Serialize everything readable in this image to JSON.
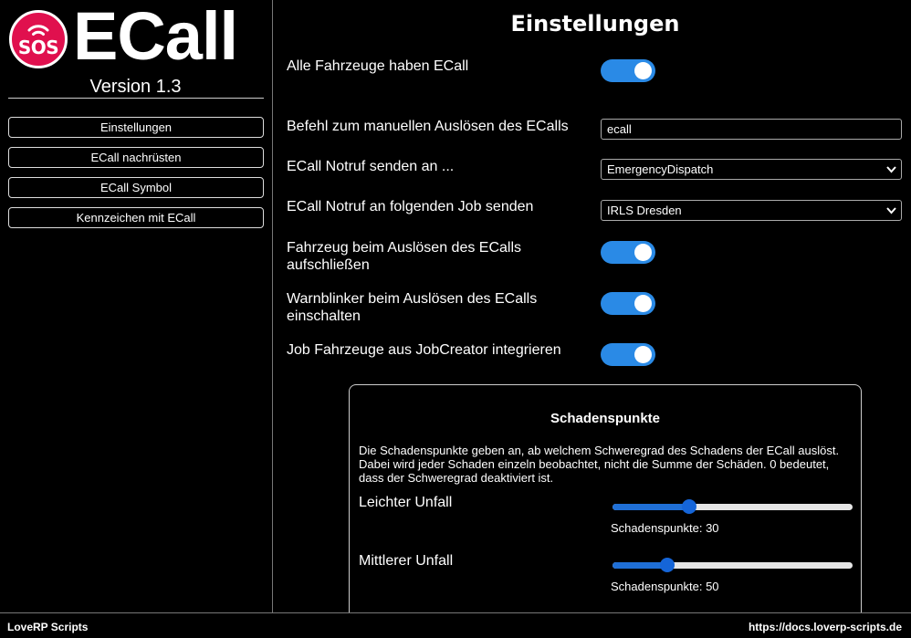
{
  "sidebar": {
    "logo": {
      "badge_text": "SOS",
      "brand": "ECall",
      "badge_color": "#e0104e"
    },
    "version": "Version 1.3",
    "nav": [
      {
        "label": "Einstellungen"
      },
      {
        "label": "ECall nachrüsten"
      },
      {
        "label": "ECall Symbol"
      },
      {
        "label": "Kennzeichen mit ECall"
      }
    ]
  },
  "main": {
    "title": "Einstellungen",
    "settings": {
      "all_vehicles": {
        "label": "Alle Fahrzeuge haben ECall",
        "enabled": true
      },
      "manual_command": {
        "label": "Befehl zum manuellen Auslösen des ECalls",
        "value": "ecall"
      },
      "send_to": {
        "label": "ECall Notruf senden an ...",
        "selected": "EmergencyDispatch"
      },
      "send_to_job": {
        "label": "ECall Notruf an folgenden Job senden",
        "selected": "IRLS Dresden"
      },
      "unlock_vehicle": {
        "label_line1": "Fahrzeug beim Auslösen des ECalls",
        "label_line2": "aufschließen",
        "enabled": true
      },
      "hazard_lights": {
        "label_line1": "Warnblinker beim Auslösen des ECalls",
        "label_line2": "einschalten",
        "enabled": true
      },
      "jobcreator": {
        "label": "Job Fahrzeuge aus JobCreator integrieren",
        "enabled": true
      }
    },
    "damage": {
      "title": "Schadenspunkte",
      "description": "Die Schadenspunkte geben an, ab welchem Schweregrad des Schadens der ECall auslöst. Dabei wird jeder Schaden einzeln beobachtet, nicht die Summe der Schäden. 0 bedeutet, dass der Schweregrad deaktiviert ist.",
      "light": {
        "label": "Leichter Unfall",
        "value_text": "Schadenspunkte: 30",
        "fraction": 0.32
      },
      "medium": {
        "label": "Mittlerer Unfall",
        "value_text": "Schadenspunkte: 50",
        "fraction": 0.23
      }
    }
  },
  "footer": {
    "left": "LoveRP Scripts",
    "right": "https://docs.loverp-scripts.de"
  },
  "colors": {
    "accent": "#2a8ae6",
    "slider": "#1565d8",
    "background": "#000000"
  }
}
